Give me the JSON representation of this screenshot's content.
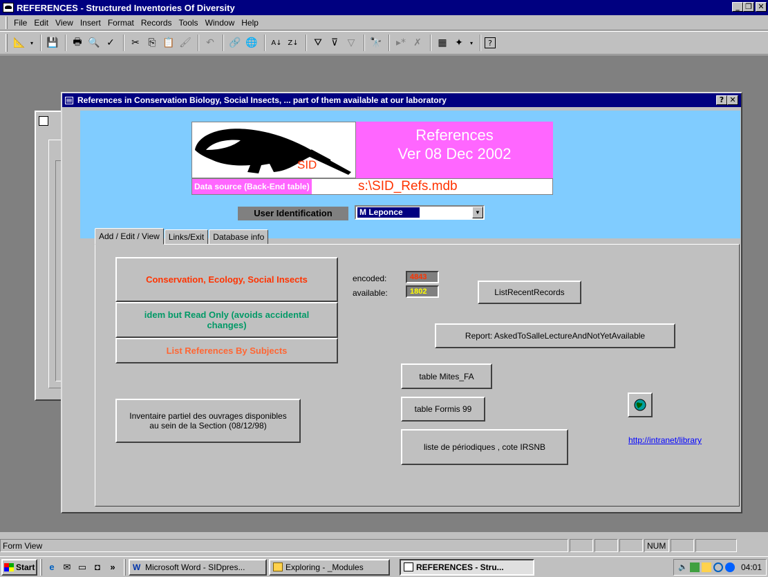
{
  "app": {
    "title": "REFERENCES - Structured Inventories Of Diversity",
    "win_buttons": [
      "_",
      "❐",
      "✕"
    ]
  },
  "menu": {
    "items": [
      {
        "label": "File"
      },
      {
        "label": "Edit"
      },
      {
        "label": "View"
      },
      {
        "label": "Insert"
      },
      {
        "label": "Format"
      },
      {
        "label": "Records"
      },
      {
        "label": "Tools"
      },
      {
        "label": "Window"
      },
      {
        "label": "Help"
      }
    ]
  },
  "toolbar": {
    "icons": [
      "design-view-icon",
      "save-icon",
      "print-icon",
      "print-preview-icon",
      "spelling-icon",
      "cut-icon",
      "copy-icon",
      "paste-icon",
      "format-painter-icon",
      "undo-icon",
      "insert-hyperlink-icon",
      "web-toolbar-icon",
      "sort-ascending-icon",
      "sort-descending-icon",
      "filter-by-selection-icon",
      "filter-by-form-icon",
      "apply-filter-icon",
      "find-icon",
      "new-record-icon",
      "delete-record-icon",
      "database-window-icon",
      "new-object-icon",
      "help-icon"
    ]
  },
  "form": {
    "title": "References in Conservation Biology, Social Insects, ... part of them available at our laboratory",
    "help_button": "?",
    "close_button": "✕",
    "logo_text": "SID",
    "version_line1": "References",
    "version_line2": "Ver 08 Dec 2002",
    "data_source_label": "Data source (Back-End table)",
    "data_source_value": "s:\\SID_Refs.mdb",
    "user_label": "User Identification",
    "user_value": "M Leponce",
    "tabs": [
      {
        "label": "Add / Edit / View",
        "active": true
      },
      {
        "label": "Links/Exit",
        "active": false
      },
      {
        "label": "Database info",
        "active": false
      }
    ],
    "buttons": {
      "conservation": "Conservation, Ecology, Social Insects",
      "readonly": "idem but Read Only (avoids accidental changes)",
      "by_subjects": "List References By Subjects",
      "inventaire": "Inventaire partiel des ouvrages disponibles au sein de la Section (08/12/98)",
      "recent": "ListRecentRecords",
      "report": "Report: AskedToSalleLectureAndNotYetAvailable",
      "mites": "table Mites_FA",
      "formis": "table Formis 99",
      "periodiques": "liste de périodiques , cote IRSNB"
    },
    "counts": {
      "encoded_label": "encoded:",
      "encoded_value": "4843",
      "available_label": "available:",
      "available_value": "1802"
    },
    "link": "http://intranet/library"
  },
  "colors": {
    "title_bar": "#000080",
    "sky": "#80ccff",
    "pink": "#ff66ff",
    "orange_red": "#ff3300",
    "teal": "#009966",
    "orange": "#ff6633",
    "yellow": "#ffff00"
  },
  "statusbar": {
    "text": "Form View",
    "num": "NUM"
  },
  "taskbar": {
    "start": "Start",
    "chevron": "»",
    "tasks": [
      {
        "label": "Microsoft Word - SIDpres..."
      },
      {
        "label": "Exploring - _Modules"
      },
      {
        "label": "REFERENCES - Stru..."
      }
    ],
    "clock": "04:01"
  }
}
